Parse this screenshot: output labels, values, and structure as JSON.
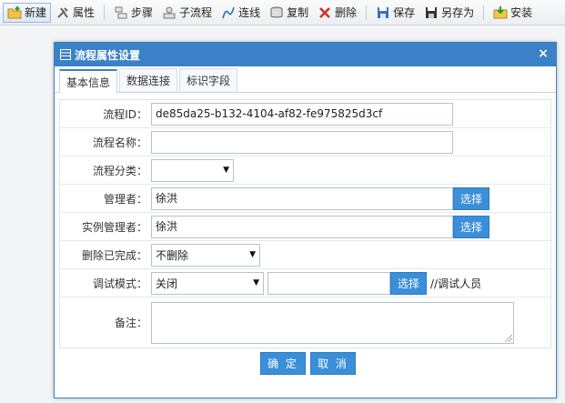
{
  "toolbar": {
    "items": [
      {
        "label": "新建",
        "icon": "new-folder-icon"
      },
      {
        "label": "属性",
        "icon": "tools-icon"
      },
      {
        "label": "步骤",
        "icon": "steps-icon"
      },
      {
        "label": "子流程",
        "icon": "subflow-icon"
      },
      {
        "label": "连线",
        "icon": "connect-line-icon"
      },
      {
        "label": "复制",
        "icon": "copy-icon"
      },
      {
        "label": "删除",
        "icon": "delete-icon"
      },
      {
        "label": "保存",
        "icon": "save-icon"
      },
      {
        "label": "另存为",
        "icon": "save-as-icon"
      },
      {
        "label": "安装",
        "icon": "install-icon"
      }
    ]
  },
  "dialog": {
    "title": "流程属性设置",
    "close": "×",
    "tabs": [
      "基本信息",
      "数据连接",
      "标识字段"
    ],
    "fields": {
      "flow_id": {
        "label": "流程ID：",
        "value": "de85da25-b132-4104-af82-fe975825d3cf"
      },
      "flow_name": {
        "label": "流程名称：",
        "value": ""
      },
      "flow_category": {
        "label": "流程分类：",
        "value": ""
      },
      "manager": {
        "label": "管理者：",
        "value": "徐洪",
        "button": "选择"
      },
      "instance_manager": {
        "label": "实例管理者：",
        "value": "徐洪",
        "button": "选择"
      },
      "delete_completed": {
        "label": "删除已完成：",
        "value": "不删除"
      },
      "debug_mode": {
        "label": "调试模式：",
        "value": "关闭",
        "debug_user": "",
        "button": "选择",
        "note": "//调试人员"
      },
      "remark": {
        "label": "备注：",
        "value": ""
      }
    },
    "buttons": {
      "ok": "确 定",
      "cancel": "取 消"
    }
  },
  "colors": {
    "accent": "#3a81c7",
    "button": "#3a8fd8"
  }
}
